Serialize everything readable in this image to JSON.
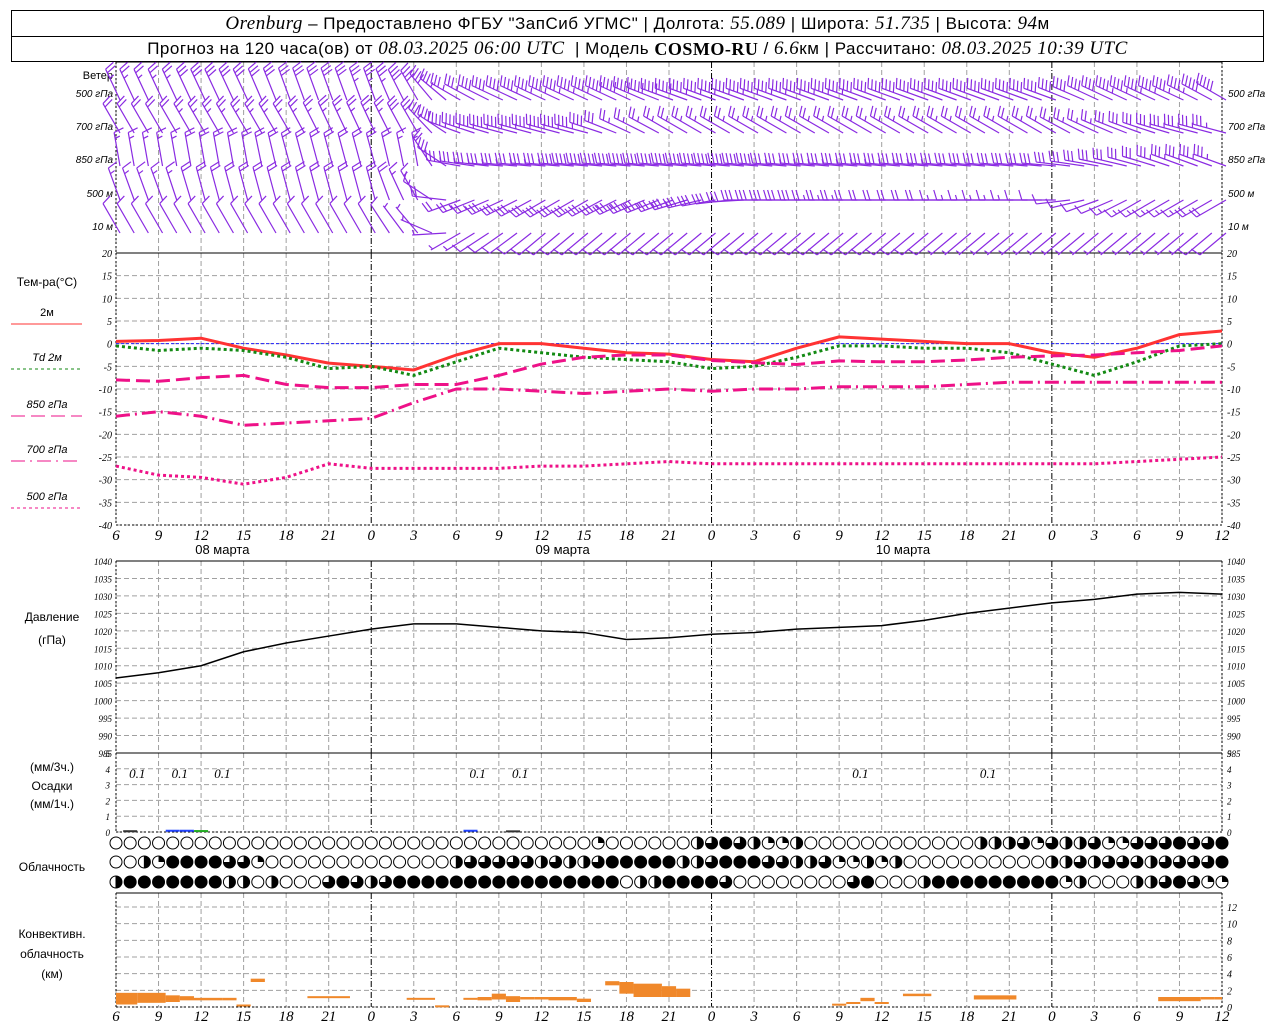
{
  "header": {
    "city": "Orenburg",
    "provider": " – Предоставлено ФГБУ \"ЗапСиб УГМС\" | Долгота: ",
    "lon": "55.089",
    "lat_label": " | Широта: ",
    "lat": "51.735",
    "alt_label": " | Высота: ",
    "alt": "94",
    "alt_unit": "м",
    "forecast_label": "Прогноз на 120 часа(ов) от ",
    "forecast_start": "08.03.2025 06:00 UTC",
    "model_label": "  | Модель ",
    "model": "COSMO-RU",
    "res_sep": " / ",
    "res": "6.6",
    "res_unit": "км",
    "calc_label": " | Рассчитано: ",
    "calc_time": "08.03.2025 10:39 UTC"
  },
  "colors": {
    "t2m": "#ff3333",
    "td2m": "#138a13",
    "t850": "#ee1188",
    "t700": "#ee1188",
    "t500": "#ee1188",
    "zero": "#2222ff",
    "pressure": "#000000",
    "wind": "#8a2be2",
    "conv": "#f0882a",
    "grid": "#a0a0a0"
  },
  "labels": {
    "wind": "Ветер",
    "levels": [
      "500 гПа",
      "700 гПа",
      "850 гПа",
      "500 м",
      "10 м"
    ],
    "temp_title": "Тем-ра(°C)",
    "temp_legend": [
      "2м",
      "Td  2м",
      "850 гПа",
      "700 гПа",
      "500 гПа"
    ],
    "pressure": "Давление",
    "pressure_unit": "(гПа)",
    "precip_3h": "(мм/3ч.)",
    "precip": "Осадки",
    "precip_1h": "(мм/1ч.)",
    "clouds": "Облачность",
    "conv1": "Конвективн.",
    "conv2": "облачность",
    "conv3": "(км)",
    "dates": [
      "08 марта",
      "09 марта",
      "10 марта"
    ]
  },
  "chart_data": {
    "type": "line",
    "time_hours_from_start": [
      0,
      3,
      6,
      9,
      12,
      15,
      18,
      21,
      24,
      27,
      30,
      33,
      36,
      39,
      42,
      45,
      48,
      51,
      54,
      57,
      60,
      63,
      66,
      69,
      72,
      75,
      78
    ],
    "tick_labels": [
      "6",
      "9",
      "12",
      "15",
      "18",
      "21",
      "0",
      "3",
      "6",
      "9",
      "12",
      "15",
      "18",
      "21",
      "0",
      "3",
      "6",
      "9",
      "12",
      "15",
      "18",
      "21",
      "0",
      "3",
      "6",
      "9",
      "12"
    ],
    "temperature": {
      "ylim": [
        -40,
        20
      ],
      "ticks": [
        20,
        15,
        10,
        5,
        0,
        -5,
        -10,
        -15,
        -20,
        -25,
        -30,
        -35,
        -40
      ],
      "series": [
        {
          "name": "2м",
          "style": "solid",
          "values": [
            0.5,
            0.7,
            1.2,
            -1,
            -2.5,
            -4.3,
            -5,
            -5.8,
            -2.5,
            0,
            0,
            -1,
            -2,
            -2.3,
            -3.5,
            -4,
            -1,
            1.5,
            1,
            0.5,
            0,
            0,
            -2,
            -3,
            -1,
            2,
            2.8
          ]
        },
        {
          "name": "Td  2м",
          "style": "dotted",
          "values": [
            -0.5,
            -1.5,
            -1,
            -1.5,
            -3,
            -5.5,
            -5,
            -7,
            -4,
            -1,
            -2,
            -3,
            -3.5,
            -4,
            -5.5,
            -5,
            -3,
            -0.5,
            -0.5,
            -1,
            -1,
            -2,
            -4.5,
            -7,
            -4,
            -0.5,
            0
          ]
        },
        {
          "name": "850 гПа",
          "style": "longdash",
          "values": [
            -8,
            -8.3,
            -7.5,
            -7,
            -9,
            -9.7,
            -9.7,
            -9,
            -9,
            -7,
            -4.5,
            -3,
            -2.5,
            -2.5,
            -3.7,
            -4.2,
            -4.6,
            -3.8,
            -4,
            -4,
            -3.6,
            -3,
            -2.7,
            -2.5,
            -2,
            -1.5,
            -0.5
          ]
        },
        {
          "name": "700 гПа",
          "style": "dashdot",
          "values": [
            -16,
            -15,
            -16,
            -18,
            -17.5,
            -17,
            -16.5,
            -13,
            -10,
            -10,
            -10.5,
            -11,
            -10.5,
            -10,
            -10.5,
            -10,
            -10,
            -9.5,
            -9.5,
            -9.5,
            -9,
            -8.5,
            -8.5,
            -8.5,
            -8.5,
            -8.5,
            -8.5
          ]
        },
        {
          "name": "500 гПа",
          "style": "dotted",
          "values": [
            -27,
            -29,
            -29.5,
            -31,
            -29.5,
            -26.5,
            -27.5,
            -27.5,
            -27.5,
            -27.5,
            -27,
            -27,
            -26.5,
            -26,
            -26.5,
            -26.5,
            -26.5,
            -26.5,
            -26.5,
            -26.5,
            -26.5,
            -26.5,
            -26.5,
            -26.5,
            -26,
            -25.5,
            -25
          ]
        }
      ]
    },
    "pressure": {
      "ylim": [
        985,
        1040
      ],
      "ticks": [
        1040,
        1035,
        1030,
        1025,
        1020,
        1015,
        1010,
        1005,
        1000,
        995,
        990,
        985
      ],
      "values": [
        1006.5,
        1008,
        1010,
        1014,
        1016.5,
        1018.5,
        1020.5,
        1022,
        1022,
        1021,
        1020,
        1019.5,
        1017.5,
        1018,
        1019,
        1019.5,
        1020.5,
        1021,
        1021.5,
        1023,
        1025,
        1026.5,
        1028,
        1029,
        1030.5,
        1031,
        1030.5
      ]
    },
    "precipitation": {
      "ylim": [
        0,
        5
      ],
      "ticks": [
        5,
        4,
        3,
        2,
        1,
        0
      ],
      "totals_3h": [
        {
          "h": 1.5,
          "label": "0.1"
        },
        {
          "h": 4.5,
          "label": "0.1"
        },
        {
          "h": 7.5,
          "label": "0.1"
        },
        {
          "h": 25.5,
          "label": "0.1"
        },
        {
          "h": 28.5,
          "label": "0.1"
        },
        {
          "h": 52.5,
          "label": "0.1"
        },
        {
          "h": 61.5,
          "label": "0.1"
        }
      ],
      "hourly": [
        {
          "h": 1,
          "v": 0.05,
          "c": "#333333"
        },
        {
          "h": 4,
          "v": 0.08,
          "c": "#2244ff"
        },
        {
          "h": 5,
          "v": 0.08,
          "c": "#2244ff"
        },
        {
          "h": 6,
          "v": 0.06,
          "c": "#22aa22"
        },
        {
          "h": 25,
          "v": 0.08,
          "c": "#2244ff"
        },
        {
          "h": 28,
          "v": 0.04,
          "c": "#333333"
        }
      ]
    },
    "clouds": {
      "scale": "0=clear,1=1/4,2=1/2,3=3/4,4=overcast",
      "high": [
        0,
        0,
        0,
        0,
        0,
        0,
        0,
        0,
        0,
        0,
        0,
        0,
        0,
        0,
        0,
        0,
        0,
        0,
        0,
        0,
        0,
        0,
        0,
        0,
        0,
        0,
        0,
        0,
        0,
        0,
        0,
        0,
        0,
        0,
        1,
        0,
        0,
        0,
        0,
        0,
        0,
        2,
        3,
        4,
        3,
        2,
        1,
        1,
        2,
        0,
        0,
        0,
        0,
        0,
        0,
        0,
        0,
        0,
        0,
        0,
        0,
        2,
        2,
        2,
        3,
        1,
        3,
        2,
        2,
        3,
        1,
        1,
        3,
        3,
        3,
        4,
        3,
        3,
        4
      ],
      "middle": [
        0,
        0,
        2,
        1,
        4,
        4,
        4,
        4,
        3,
        3,
        1,
        0,
        0,
        0,
        0,
        0,
        0,
        0,
        0,
        0,
        0,
        0,
        0,
        0,
        2,
        3,
        3,
        3,
        3,
        3,
        2,
        3,
        2,
        2,
        3,
        4,
        4,
        4,
        4,
        4,
        2,
        2,
        3,
        4,
        4,
        4,
        3,
        3,
        2,
        2,
        3,
        1,
        1,
        2,
        1,
        2,
        0,
        0,
        0,
        0,
        0,
        0,
        0,
        0,
        0,
        0,
        2,
        2,
        3,
        2,
        3,
        3,
        3,
        2,
        3,
        3,
        3,
        3,
        4
      ],
      "low": [
        2,
        4,
        4,
        4,
        4,
        4,
        4,
        4,
        2,
        2,
        0,
        2,
        0,
        0,
        0,
        3,
        4,
        3,
        2,
        3,
        4,
        4,
        4,
        4,
        4,
        4,
        4,
        4,
        4,
        4,
        4,
        4,
        4,
        4,
        4,
        4,
        0,
        2,
        2,
        4,
        4,
        4,
        4,
        3,
        0,
        0,
        0,
        0,
        0,
        0,
        0,
        0,
        3,
        4,
        0,
        0,
        0,
        2,
        4,
        4,
        4,
        4,
        4,
        4,
        4,
        4,
        4,
        1,
        2,
        0,
        0,
        0,
        2,
        2,
        3,
        4,
        3,
        1,
        1
      ]
    },
    "convective": {
      "ylim": [
        0,
        13
      ],
      "ticks": [
        12,
        10,
        8,
        6,
        4,
        2,
        0
      ],
      "layers_h_start_end_base_top_km": [
        [
          0,
          1.5,
          0.3,
          1.7
        ],
        [
          1.5,
          3.5,
          0.5,
          1.7
        ],
        [
          3.5,
          4.5,
          0.6,
          1.4
        ],
        [
          4.5,
          5.5,
          0.8,
          1.3
        ],
        [
          5.5,
          7.5,
          0.8,
          1.1
        ],
        [
          7.5,
          8.5,
          0.8,
          1.1
        ],
        [
          8.5,
          9.5,
          0.2,
          0.3
        ],
        [
          9.5,
          10.5,
          3.0,
          3.4
        ],
        [
          13.5,
          16.5,
          1.1,
          1.3
        ],
        [
          20.5,
          22.5,
          0.9,
          1.1
        ],
        [
          22.5,
          23.5,
          0.1,
          0.2
        ],
        [
          24.5,
          25.5,
          0.9,
          1.1
        ],
        [
          25.5,
          26.5,
          0.8,
          1.2
        ],
        [
          26.5,
          27.5,
          0.9,
          1.6
        ],
        [
          27.5,
          28.5,
          0.6,
          1.3
        ],
        [
          28.5,
          29.5,
          0.9,
          1.2
        ],
        [
          29.5,
          30.5,
          0.9,
          1.2
        ],
        [
          30.5,
          32.5,
          0.8,
          1.2
        ],
        [
          32.5,
          33.5,
          0.6,
          1.0
        ],
        [
          34.5,
          35.5,
          2.6,
          3.1
        ],
        [
          35.5,
          36.5,
          1.6,
          3.0
        ],
        [
          36.5,
          38.5,
          1.2,
          2.8
        ],
        [
          38.5,
          39.5,
          1.2,
          2.5
        ],
        [
          39.5,
          40.5,
          1.2,
          2.2
        ],
        [
          50.5,
          51.5,
          0.2,
          0.4
        ],
        [
          51.5,
          52.5,
          0.4,
          0.6
        ],
        [
          52.5,
          53.5,
          0.7,
          1.1
        ],
        [
          53.5,
          54.5,
          0.4,
          0.6
        ],
        [
          55.5,
          57.5,
          1.3,
          1.6
        ],
        [
          60.5,
          63.5,
          0.9,
          1.4
        ],
        [
          73.5,
          76.5,
          0.7,
          1.2
        ],
        [
          76.5,
          77.5,
          0.9,
          1.2
        ],
        [
          77.5,
          78,
          0.9,
          1.2
        ]
      ]
    },
    "wind": {
      "units": "kt",
      "levels": [
        {
          "name": "500 гПа",
          "dir": [
            335,
            335,
            335,
            335,
            340,
            340,
            340,
            330,
            300,
            295,
            295,
            295,
            295,
            290,
            290,
            290,
            290,
            290,
            290,
            290,
            290,
            290,
            290,
            295,
            295,
            295,
            300
          ],
          "speed": [
            25,
            25,
            30,
            30,
            30,
            30,
            35,
            40,
            35,
            40,
            45,
            45,
            50,
            50,
            45,
            45,
            45,
            45,
            40,
            40,
            40,
            40,
            40,
            40,
            45,
            45,
            50
          ]
        },
        {
          "name": "700 гПа",
          "dir": [
            330,
            330,
            330,
            330,
            330,
            335,
            335,
            330,
            290,
            285,
            285,
            285,
            295,
            300,
            300,
            300,
            300,
            300,
            300,
            300,
            300,
            300,
            300,
            295,
            290,
            285,
            285
          ],
          "speed": [
            20,
            20,
            25,
            25,
            25,
            25,
            25,
            30,
            45,
            45,
            45,
            45,
            25,
            25,
            25,
            25,
            25,
            25,
            25,
            25,
            25,
            25,
            25,
            25,
            30,
            35,
            35
          ]
        },
        {
          "name": "850 гПа",
          "dir": [
            350,
            350,
            350,
            350,
            345,
            345,
            345,
            350,
            280,
            275,
            275,
            275,
            275,
            275,
            275,
            275,
            275,
            275,
            275,
            275,
            275,
            275,
            275,
            280,
            285,
            290,
            290
          ],
          "speed": [
            15,
            15,
            20,
            20,
            20,
            20,
            20,
            15,
            35,
            35,
            35,
            40,
            40,
            40,
            40,
            40,
            35,
            35,
            35,
            35,
            30,
            30,
            30,
            30,
            30,
            35,
            35
          ]
        },
        {
          "name": "500 м",
          "dir": [
            340,
            340,
            345,
            345,
            345,
            345,
            345,
            330,
            250,
            245,
            240,
            240,
            245,
            250,
            260,
            270,
            270,
            270,
            270,
            270,
            270,
            270,
            270,
            250,
            240,
            240,
            240
          ],
          "speed": [
            15,
            15,
            20,
            20,
            20,
            20,
            20,
            15,
            20,
            30,
            30,
            30,
            35,
            35,
            30,
            30,
            30,
            25,
            20,
            20,
            15,
            15,
            10,
            10,
            15,
            15,
            20
          ]
        },
        {
          "name": "10 м",
          "dir": [
            330,
            330,
            330,
            330,
            330,
            330,
            330,
            320,
            240,
            235,
            230,
            230,
            230,
            230,
            230,
            230,
            230,
            230,
            230,
            230,
            230,
            230,
            230,
            230,
            230,
            230,
            230
          ],
          "speed": [
            10,
            10,
            10,
            10,
            10,
            10,
            10,
            5,
            5,
            10,
            10,
            10,
            10,
            10,
            10,
            10,
            10,
            10,
            10,
            10,
            5,
            5,
            5,
            5,
            5,
            5,
            10
          ]
        }
      ]
    }
  }
}
